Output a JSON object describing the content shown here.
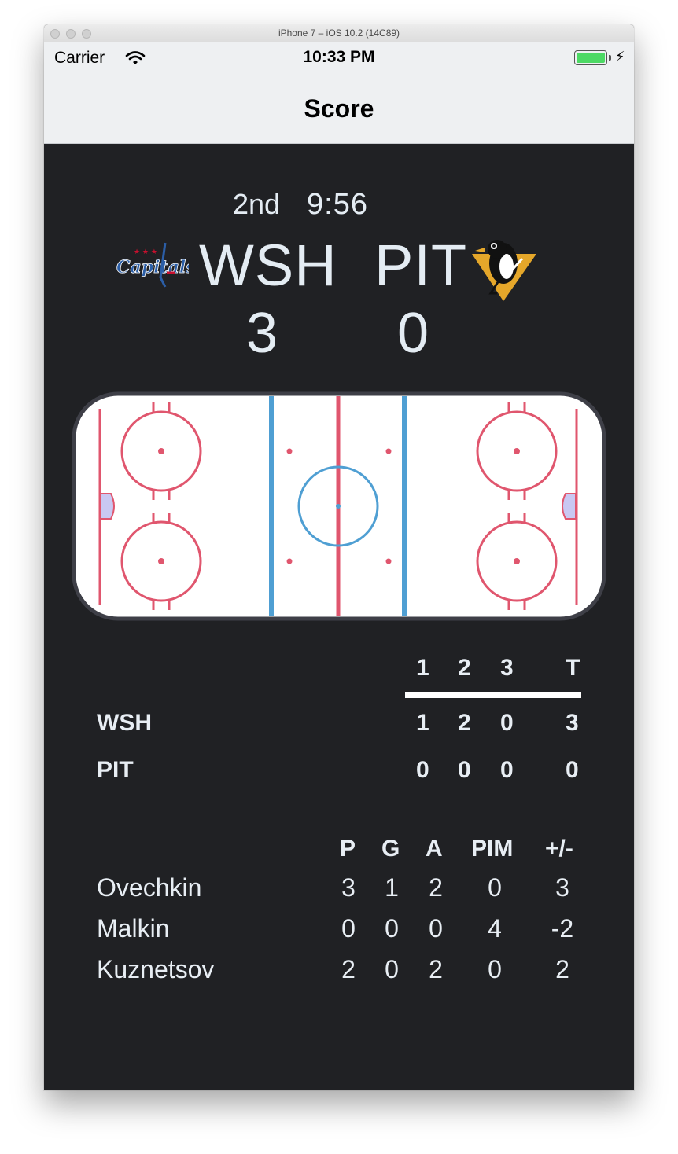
{
  "window": {
    "title": "iPhone 7 – iOS 10.2 (14C89)"
  },
  "status_bar": {
    "carrier": "Carrier",
    "time": "10:33 PM"
  },
  "nav": {
    "title": "Score"
  },
  "game": {
    "period": "2nd",
    "clock": "9:56",
    "home": {
      "abbr": "WSH",
      "score": "3",
      "logo_text": "Capitals"
    },
    "away": {
      "abbr": "PIT",
      "score": "0"
    }
  },
  "periods": {
    "headers": [
      "1",
      "2",
      "3",
      "T"
    ],
    "rows": [
      {
        "team": "WSH",
        "values": [
          "1",
          "2",
          "0",
          "3"
        ]
      },
      {
        "team": "PIT",
        "values": [
          "0",
          "0",
          "0",
          "0"
        ]
      }
    ]
  },
  "player_stats": {
    "headers": [
      "P",
      "G",
      "A",
      "PIM",
      "+/-"
    ],
    "rows": [
      {
        "name": "Ovechkin",
        "values": [
          "3",
          "1",
          "2",
          "0",
          "3"
        ]
      },
      {
        "name": "Malkin",
        "values": [
          "0",
          "0",
          "0",
          "4",
          "-2"
        ]
      },
      {
        "name": "Kuznetsov",
        "values": [
          "2",
          "0",
          "2",
          "0",
          "2"
        ]
      }
    ]
  },
  "colors": {
    "background": "#202124",
    "text": "#e8eef4",
    "rink_red": "#e0566e",
    "rink_blue": "#4f9fd3",
    "crease": "#c9c8f2"
  }
}
